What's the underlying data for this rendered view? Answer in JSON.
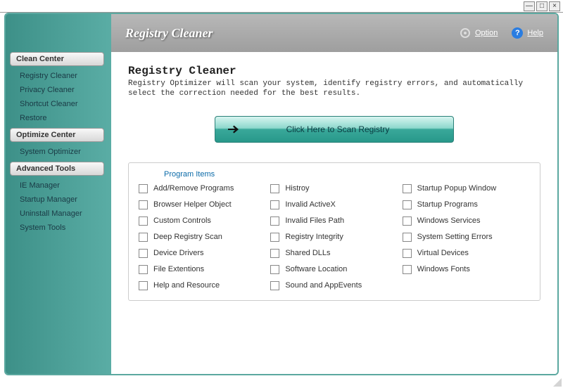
{
  "app": {
    "title": "Registry Cleaner"
  },
  "header": {
    "option_label": "Option",
    "help_label": "Help"
  },
  "sidebar": {
    "sections": [
      {
        "header": "Clean Center",
        "items": [
          "Registry Cleaner",
          "Privacy Cleaner",
          "Shortcut Cleaner",
          "Restore"
        ]
      },
      {
        "header": "Optimize Center",
        "items": [
          "System Optimizer"
        ]
      },
      {
        "header": "Advanced Tools",
        "items": [
          "IE Manager",
          "Startup Manager",
          "Uninstall Manager",
          "System Tools"
        ]
      }
    ]
  },
  "main": {
    "title": "Registry Cleaner",
    "description": "Registry Optimizer will scan your system, identify registry errors, and automatically select the correction needed for the best results.",
    "scan_button": "Click Here to Scan Registry",
    "program_items_header": "Program Items",
    "program_items": {
      "col1": [
        "Add/Remove Programs",
        "Browser Helper Object",
        "Custom Controls",
        "Deep Registry Scan",
        "Device Drivers",
        "File Extentions",
        "Help and Resource"
      ],
      "col2": [
        "Histroy",
        "Invalid ActiveX",
        "Invalid Files Path",
        "Registry Integrity",
        "Shared DLLs",
        "Software Location",
        "Sound and AppEvents"
      ],
      "col3": [
        "Startup Popup Window",
        "Startup Programs",
        "Windows Services",
        "System Setting Errors",
        "Virtual Devices",
        "Windows Fonts"
      ]
    }
  }
}
